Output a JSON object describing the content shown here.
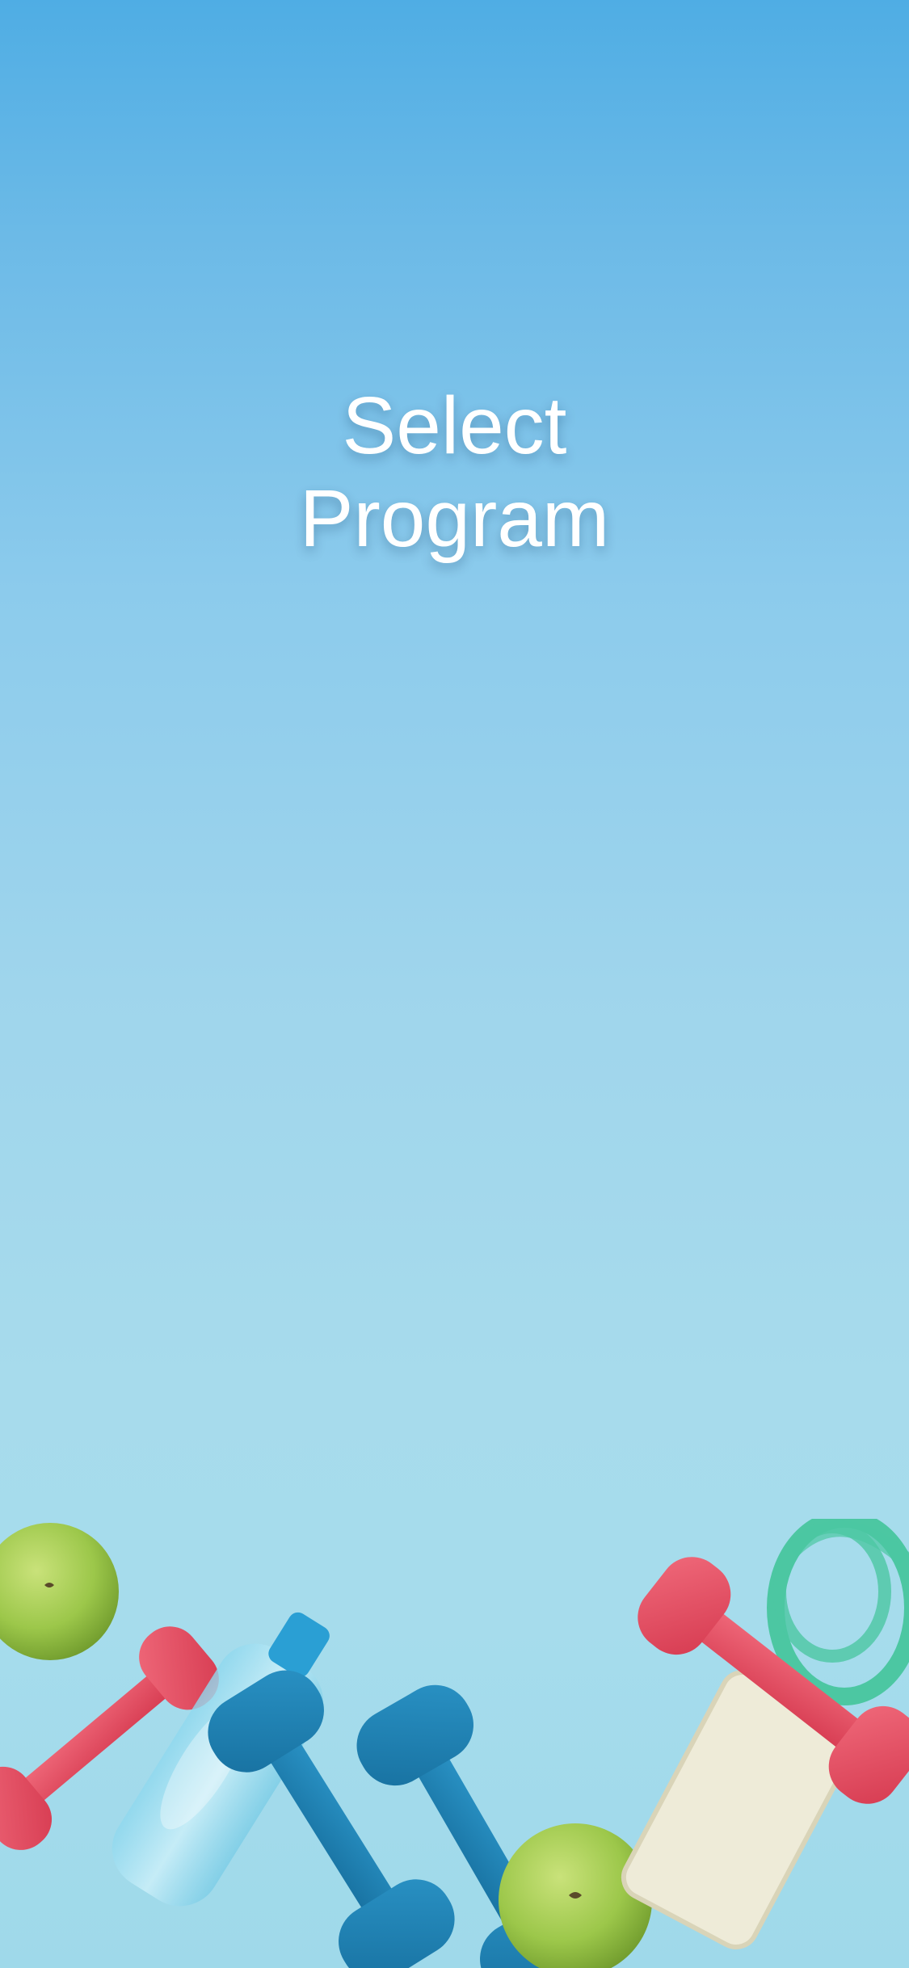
{
  "screen": {
    "title_line1": "Select",
    "title_line2": "Program"
  },
  "background": {
    "gradient_top": "#4fade4",
    "gradient_bottom": "#a6dcec"
  },
  "illustration": {
    "items": [
      "apple-icon",
      "red-dumbbell-icon",
      "water-bottle-icon",
      "blue-dumbbell-icon",
      "blue-dumbbell-icon",
      "apple-icon",
      "towel-icon",
      "red-dumbbell-icon",
      "measuring-tape-icon"
    ],
    "colors": {
      "red_dumbbell": "#e34a5e",
      "blue_dumbbell": "#1f82b4",
      "apple": "#9cc74a",
      "tape": "#4cc7a2",
      "towel": "#eeebd8"
    }
  }
}
